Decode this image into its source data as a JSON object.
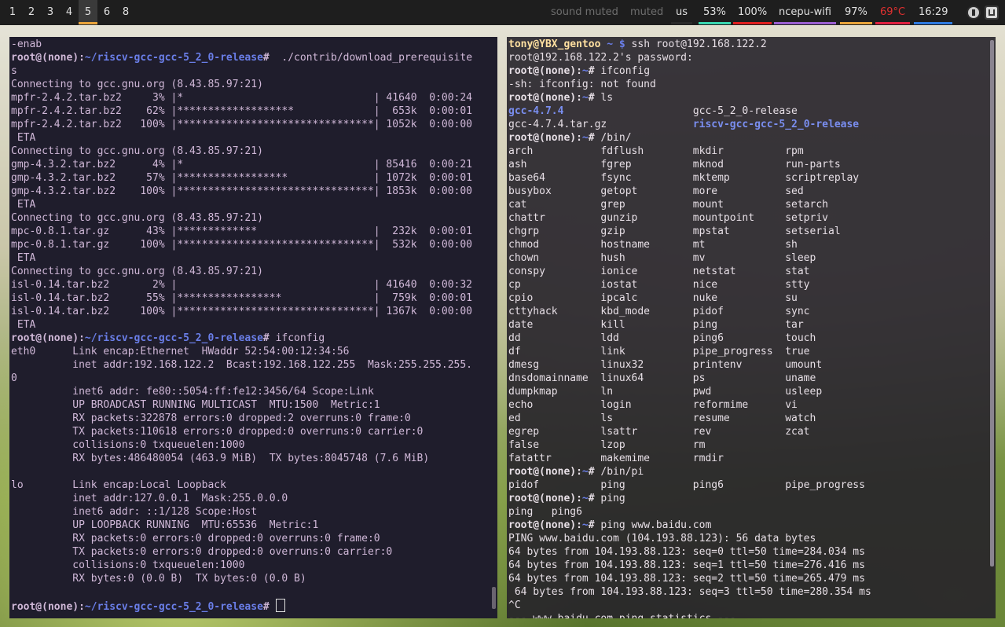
{
  "workspaces": [
    "1",
    "2",
    "3",
    "4",
    "5",
    "6",
    "8"
  ],
  "status": {
    "sound": "sound muted",
    "muted": "muted",
    "layout": "us",
    "battery": "53%",
    "brightness": "100%",
    "wifi": "ncepu-wifi",
    "wifi_signal": "97%",
    "temp": "69°C",
    "clock": "16:29"
  },
  "colors": {
    "accent_orange": "#e8a33a",
    "accent_teal": "#3ad6b0",
    "accent_red": "#e02020",
    "accent_purple": "#9a5ed0",
    "temp_red": "#e03030",
    "host_green": "#5f9e4a",
    "path_blue": "#6a7ee8"
  },
  "left_terminal": {
    "lines": [
      "-enab",
      "root@(none):~/riscv-gcc-gcc-5_2_0-release#  ./contrib/download_prerequisite",
      "s",
      "Connecting to gcc.gnu.org (8.43.85.97:21)",
      "mpfr-2.4.2.tar.bz2     3% |*                               | 41640  0:00:24",
      "mpfr-2.4.2.tar.bz2    62% |*******************             |  653k  0:00:01",
      "mpfr-2.4.2.tar.bz2   100% |********************************| 1052k  0:00:00",
      " ETA",
      "Connecting to gcc.gnu.org (8.43.85.97:21)",
      "gmp-4.3.2.tar.bz2      4% |*                               | 85416  0:00:21",
      "gmp-4.3.2.tar.bz2     57% |******************              | 1072k  0:00:01",
      "gmp-4.3.2.tar.bz2    100% |********************************| 1853k  0:00:00",
      " ETA",
      "Connecting to gcc.gnu.org (8.43.85.97:21)",
      "mpc-0.8.1.tar.gz      43% |*************                   |  232k  0:00:01",
      "mpc-0.8.1.tar.gz     100% |********************************|  532k  0:00:00",
      " ETA",
      "Connecting to gcc.gnu.org (8.43.85.97:21)",
      "isl-0.14.tar.bz2       2% |                                | 41640  0:00:32",
      "isl-0.14.tar.bz2      55% |*****************               |  759k  0:00:01",
      "isl-0.14.tar.bz2     100% |********************************| 1367k  0:00:00",
      " ETA",
      "root@(none):~/riscv-gcc-gcc-5_2_0-release# ifconfig",
      "eth0      Link encap:Ethernet  HWaddr 52:54:00:12:34:56",
      "          inet addr:192.168.122.2  Bcast:192.168.122.255  Mask:255.255.255.",
      "0",
      "          inet6 addr: fe80::5054:ff:fe12:3456/64 Scope:Link",
      "          UP BROADCAST RUNNING MULTICAST  MTU:1500  Metric:1",
      "          RX packets:322878 errors:0 dropped:2 overruns:0 frame:0",
      "          TX packets:110618 errors:0 dropped:0 overruns:0 carrier:0",
      "          collisions:0 txqueuelen:1000",
      "          RX bytes:486480054 (463.9 MiB)  TX bytes:8045748 (7.6 MiB)",
      "",
      "lo        Link encap:Local Loopback",
      "          inet addr:127.0.0.1  Mask:255.0.0.0",
      "          inet6 addr: ::1/128 Scope:Host",
      "          UP LOOPBACK RUNNING  MTU:65536  Metric:1",
      "          RX packets:0 errors:0 dropped:0 overruns:0 frame:0",
      "          TX packets:0 errors:0 dropped:0 overruns:0 carrier:0",
      "          collisions:0 txqueuelen:1000",
      "          RX bytes:0 (0.0 B)  TX bytes:0 (0.0 B)",
      "",
      "root@(none):~/riscv-gcc-gcc-5_2_0-release# "
    ]
  },
  "right_terminal": {
    "lines": [
      "tony@YBX_gentoo ~ $ ssh root@192.168.122.2",
      "root@192.168.122.2's password:",
      "root@(none):~# ifconfig",
      "-sh: ifconfig: not found",
      "root@(none):~# ls",
      "gcc-4.7.4                     gcc-5_2_0-release",
      "gcc-4.7.4.tar.gz              riscv-gcc-gcc-5_2_0-release",
      "root@(none):~# /bin/",
      "arch           fdflush        mkdir          rpm",
      "ash            fgrep          mknod          run-parts",
      "base64         fsync          mktemp         scriptreplay",
      "busybox        getopt         more           sed",
      "cat            grep           mount          setarch",
      "chattr         gunzip         mountpoint     setpriv",
      "chgrp          gzip           mpstat         setserial",
      "chmod          hostname       mt             sh",
      "chown          hush           mv             sleep",
      "conspy         ionice         netstat        stat",
      "cp             iostat         nice           stty",
      "cpio           ipcalc         nuke           su",
      "cttyhack       kbd_mode       pidof          sync",
      "date           kill           ping           tar",
      "dd             ldd            ping6          touch",
      "df             link           pipe_progress  true",
      "dmesg          linux32        printenv       umount",
      "dnsdomainname  linux64        ps             uname",
      "dumpkmap       ln             pwd            usleep",
      "echo           login          reformime      vi",
      "ed             ls             resume         watch",
      "egrep          lsattr         rev            zcat",
      "false          lzop           rm",
      "fatattr        makemime       rmdir",
      "root@(none):~# /bin/pi",
      "pidof          ping           ping6          pipe_progress",
      "root@(none):~# ping",
      "ping   ping6",
      "root@(none):~# ping www.baidu.com",
      "PING www.baidu.com (104.193.88.123): 56 data bytes",
      "64 bytes from 104.193.88.123: seq=0 ttl=50 time=284.034 ms",
      "64 bytes from 104.193.88.123: seq=1 ttl=50 time=276.416 ms",
      "64 bytes from 104.193.88.123: seq=2 ttl=50 time=265.479 ms",
      " 64 bytes from 104.193.88.123: seq=3 ttl=50 time=280.354 ms",
      "^C",
      "--- www.baidu.com ping statistics ---"
    ]
  }
}
